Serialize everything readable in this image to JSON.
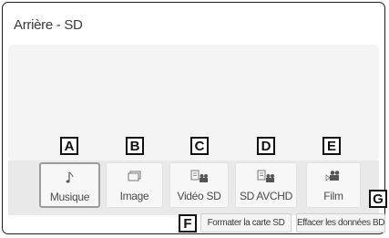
{
  "screen": {
    "title": "Arrière - SD"
  },
  "sources": [
    {
      "label": "Musique",
      "icon": "music-note-icon",
      "selected": true
    },
    {
      "label": "Image",
      "icon": "image-icon",
      "selected": false
    },
    {
      "label": "Vidéo SD",
      "icon": "video-icon",
      "selected": false
    },
    {
      "label": "SD AVCHD",
      "icon": "video-icon",
      "selected": false
    },
    {
      "label": "Film",
      "icon": "film-camera-icon",
      "selected": false
    }
  ],
  "actions": {
    "format": "Formater la carte SD",
    "erase": "Effacer les données BD"
  },
  "callouts": {
    "a": "A",
    "b": "B",
    "c": "C",
    "d": "D",
    "e": "E",
    "f": "F",
    "g": "G"
  }
}
